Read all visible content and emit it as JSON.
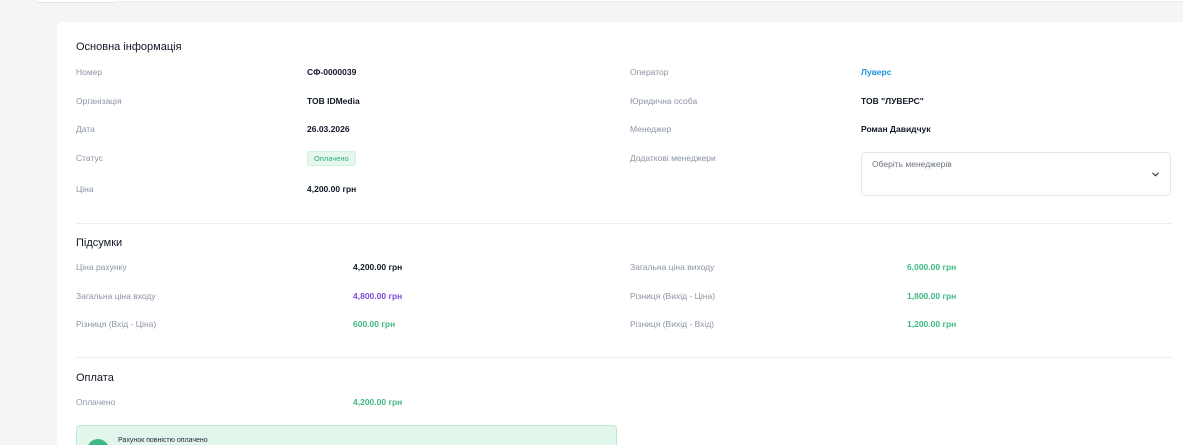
{
  "basic_info": {
    "title": "Основна інформація",
    "number_label": "Номер",
    "number_value": "СФ-0000039",
    "organization_label": "Організація",
    "organization_value": "ТОВ IDMedia",
    "date_label": "Дата",
    "date_value": "26.03.2026",
    "status_label": "Статус",
    "status_value": "Оплачено",
    "price_label": "Ціна",
    "price_value": "4,200.00 грн",
    "operator_label": "Оператор",
    "operator_value": "Луверс",
    "legal_entity_label": "Юридична особа",
    "legal_entity_value": "ТОВ \"ЛУВЕРС\"",
    "manager_label": "Менеджер",
    "manager_value": "Роман Давидчук",
    "extra_managers_label": "Додаткові менеджери",
    "extra_managers_placeholder": "Оберіть менеджерів"
  },
  "totals": {
    "title": "Підсумки",
    "invoice_price_label": "Ціна рахунку",
    "invoice_price_value": "4,200.00 грн",
    "total_in_label": "Загальна ціна входу",
    "total_in_value": "4,800.00 грн",
    "diff_in_price_label": "Різниця (Вхід - Ціна)",
    "diff_in_price_value": "600.00 грн",
    "total_out_label": "Загальна ціна виходу",
    "total_out_value": "6,000.00 грн",
    "diff_out_price_label": "Різниця (Вихід - Ціна)",
    "diff_out_price_value": "1,800.00 грн",
    "diff_out_in_label": "Різниця (Вихід - Вхід)",
    "diff_out_in_value": "1,200.00 грн"
  },
  "payment": {
    "title": "Оплата",
    "paid_label": "Оплачено",
    "paid_value": "4,200.00 грн",
    "alert_text": "Рахунок повністю оплачено"
  },
  "colors": {
    "accent_blue": "#1d8fe0",
    "positive_green": "#3fb983",
    "purple": "#7c4ddb"
  }
}
